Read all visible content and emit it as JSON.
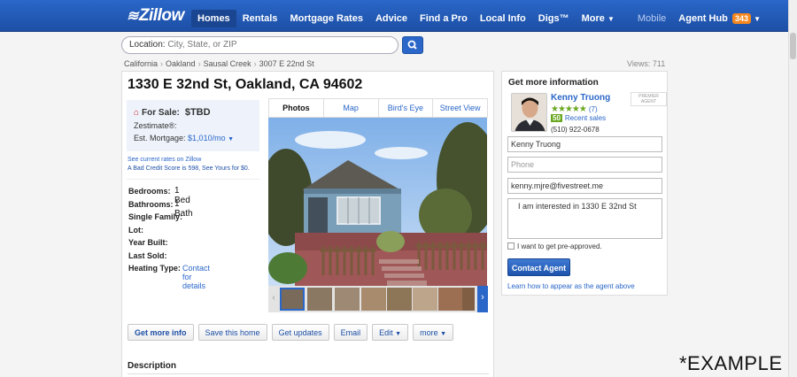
{
  "nav": {
    "logo": "Zillow",
    "links": [
      {
        "label": "Homes",
        "active": true
      },
      {
        "label": "Rentals"
      },
      {
        "label": "Mortgage Rates"
      },
      {
        "label": "Advice"
      },
      {
        "label": "Find a Pro"
      },
      {
        "label": "Local Info"
      },
      {
        "label": "Digs™"
      },
      {
        "label": "More"
      }
    ],
    "mobile": "Mobile",
    "agent_hub": "Agent Hub",
    "agent_hub_count": "343"
  },
  "search": {
    "label": "Location:",
    "placeholder": "City, State, or ZIP"
  },
  "breadcrumb": [
    "California",
    "Oakland",
    "Sausal Creek",
    "3007 E 22nd St"
  ],
  "views": "Views: 711",
  "listing": {
    "address": "1330 E 32nd St, Oakland, CA 94602",
    "for_sale_label": "For Sale:",
    "price": "$TBD",
    "zestimate": "Zestimate®:",
    "mortgage_label": "Est. Mortgage:",
    "mortgage_value": "$1,010/mo"
  },
  "rates": {
    "current": "See current rates on Zillow",
    "credit": "A Bad Credit Score is 598, See Yours for $0."
  },
  "facts": [
    {
      "key": "Bedrooms:",
      "value": "1 Bed"
    },
    {
      "key": "Bathrooms:",
      "value": "1 Bath"
    },
    {
      "key": "Single Family:",
      "value": ""
    },
    {
      "key": "Lot:",
      "value": ""
    },
    {
      "key": "Year Built:",
      "value": ""
    },
    {
      "key": "Last Sold:",
      "value": ""
    },
    {
      "key": "Heating Type:",
      "value": "Contact for details"
    }
  ],
  "photo_tabs": [
    "Photos",
    "Map",
    "Bird's Eye",
    "Street View"
  ],
  "actions": [
    "Get more info",
    "Save this home",
    "Get updates",
    "Email",
    "Edit",
    "more"
  ],
  "description_heading": "Description",
  "contact": {
    "title": "Get more information",
    "agent_name": "Kenny Truong",
    "premier": "PREMIER AGENT",
    "rating_count": "(7)",
    "recent_count": "50",
    "recent_label": "Recent sales",
    "phone": "(510) 922-0678",
    "name_value": "Kenny Truong",
    "phone_placeholder": "Phone",
    "email_value": "kenny.mjre@fivestreet.me",
    "message": "I am interested in 1330 E 32nd St",
    "preapproved": "I want to get pre-approved.",
    "button": "Contact Agent",
    "learn": "Learn how to appear as the agent above"
  },
  "example_text": "*EXAMPLE",
  "colors": {
    "brand_blue": "#2a67c9",
    "price_red": "#d21f27",
    "rating_green": "#6aa821",
    "badge_orange": "#f5871f"
  }
}
